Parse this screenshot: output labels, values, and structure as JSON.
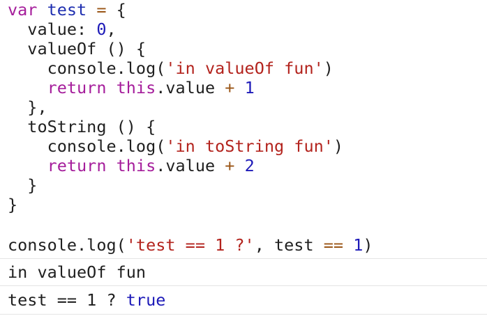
{
  "code": {
    "l1": {
      "kw": "var",
      "name": "test",
      "op": "=",
      "brace": "{"
    },
    "l2": {
      "key": "value:",
      "num": "0",
      "tail": ","
    },
    "l3": {
      "fn": "valueOf () {"
    },
    "l4": {
      "call": "console.log(",
      "str": "'in valueOf fun'",
      "close": ")"
    },
    "l5": {
      "kw": "return",
      "this": "this",
      "rest": ".value",
      "op": "+",
      "num": "1"
    },
    "l6": {
      "text": "},"
    },
    "l7": {
      "fn": "toString () {"
    },
    "l8": {
      "call": "console.log(",
      "str": "'in toString fun'",
      "close": ")"
    },
    "l9": {
      "kw": "return",
      "this": "this",
      "rest": ".value",
      "op": "+",
      "num": "2"
    },
    "l10": {
      "text": "}"
    },
    "l11": {
      "text": "}"
    }
  },
  "console": {
    "input": {
      "call": "console.log(",
      "str": "'test == 1 ?'",
      "comma": ", test",
      "op": "==",
      "num": "1",
      "close": ")"
    },
    "outputs": [
      {
        "text": "in valueOf fun"
      },
      {
        "prefix": "test == 1 ? ",
        "value": "true"
      }
    ]
  }
}
